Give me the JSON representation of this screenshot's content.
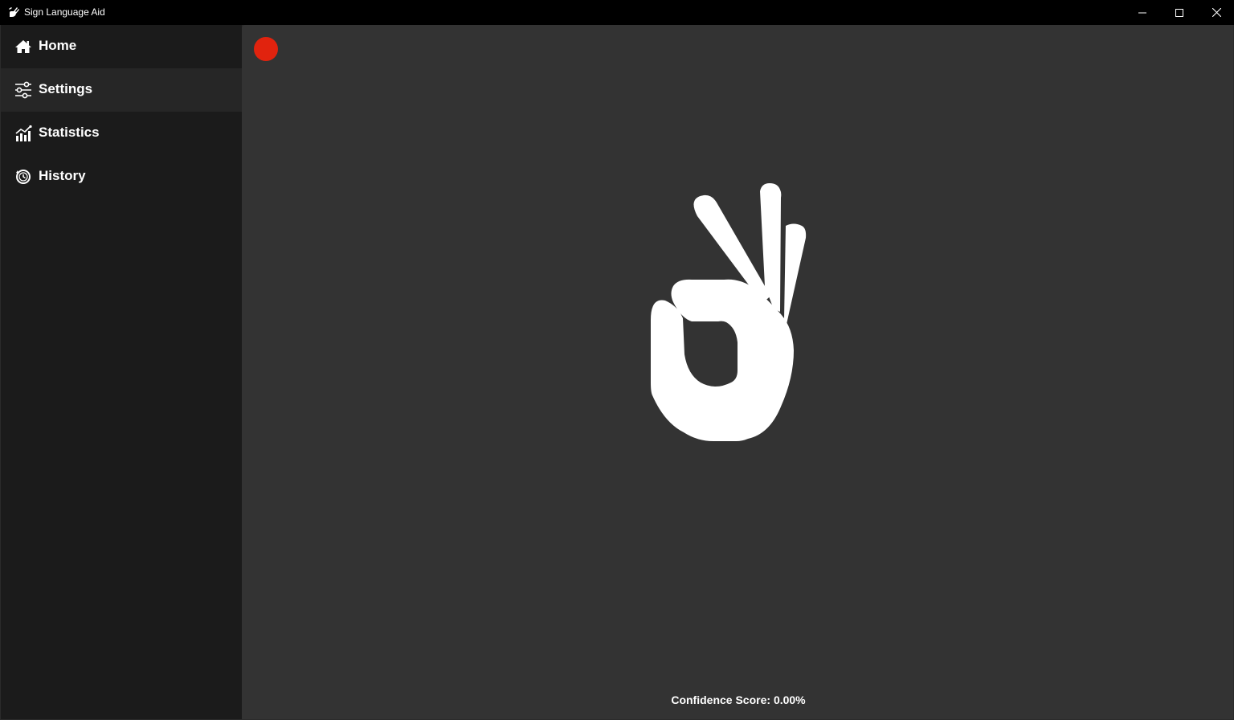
{
  "window": {
    "title": "Sign Language Aid",
    "app_icon": "hand-sign-icon",
    "controls": [
      "minimize-icon",
      "maximize-icon",
      "close-icon"
    ]
  },
  "sidebar": {
    "items": [
      {
        "label": "Home",
        "icon": "home-icon",
        "active": false
      },
      {
        "label": "Settings",
        "icon": "sliders-icon",
        "active": true
      },
      {
        "label": "Statistics",
        "icon": "chart-icon",
        "active": false
      },
      {
        "label": "History",
        "icon": "history-icon",
        "active": false
      }
    ]
  },
  "main": {
    "record_indicator": {
      "icon": "record-icon",
      "color": "#e1230e"
    },
    "sign_graphic": "ok-hand-sign-icon",
    "confidence": {
      "label": "Confidence Score:",
      "value": "0.00%"
    }
  },
  "colors": {
    "sidebar_bg": "#1b1b1b",
    "sidebar_active_bg": "#262626",
    "main_bg": "#333333",
    "titlebar_bg": "#000000",
    "record": "#e1230e"
  }
}
